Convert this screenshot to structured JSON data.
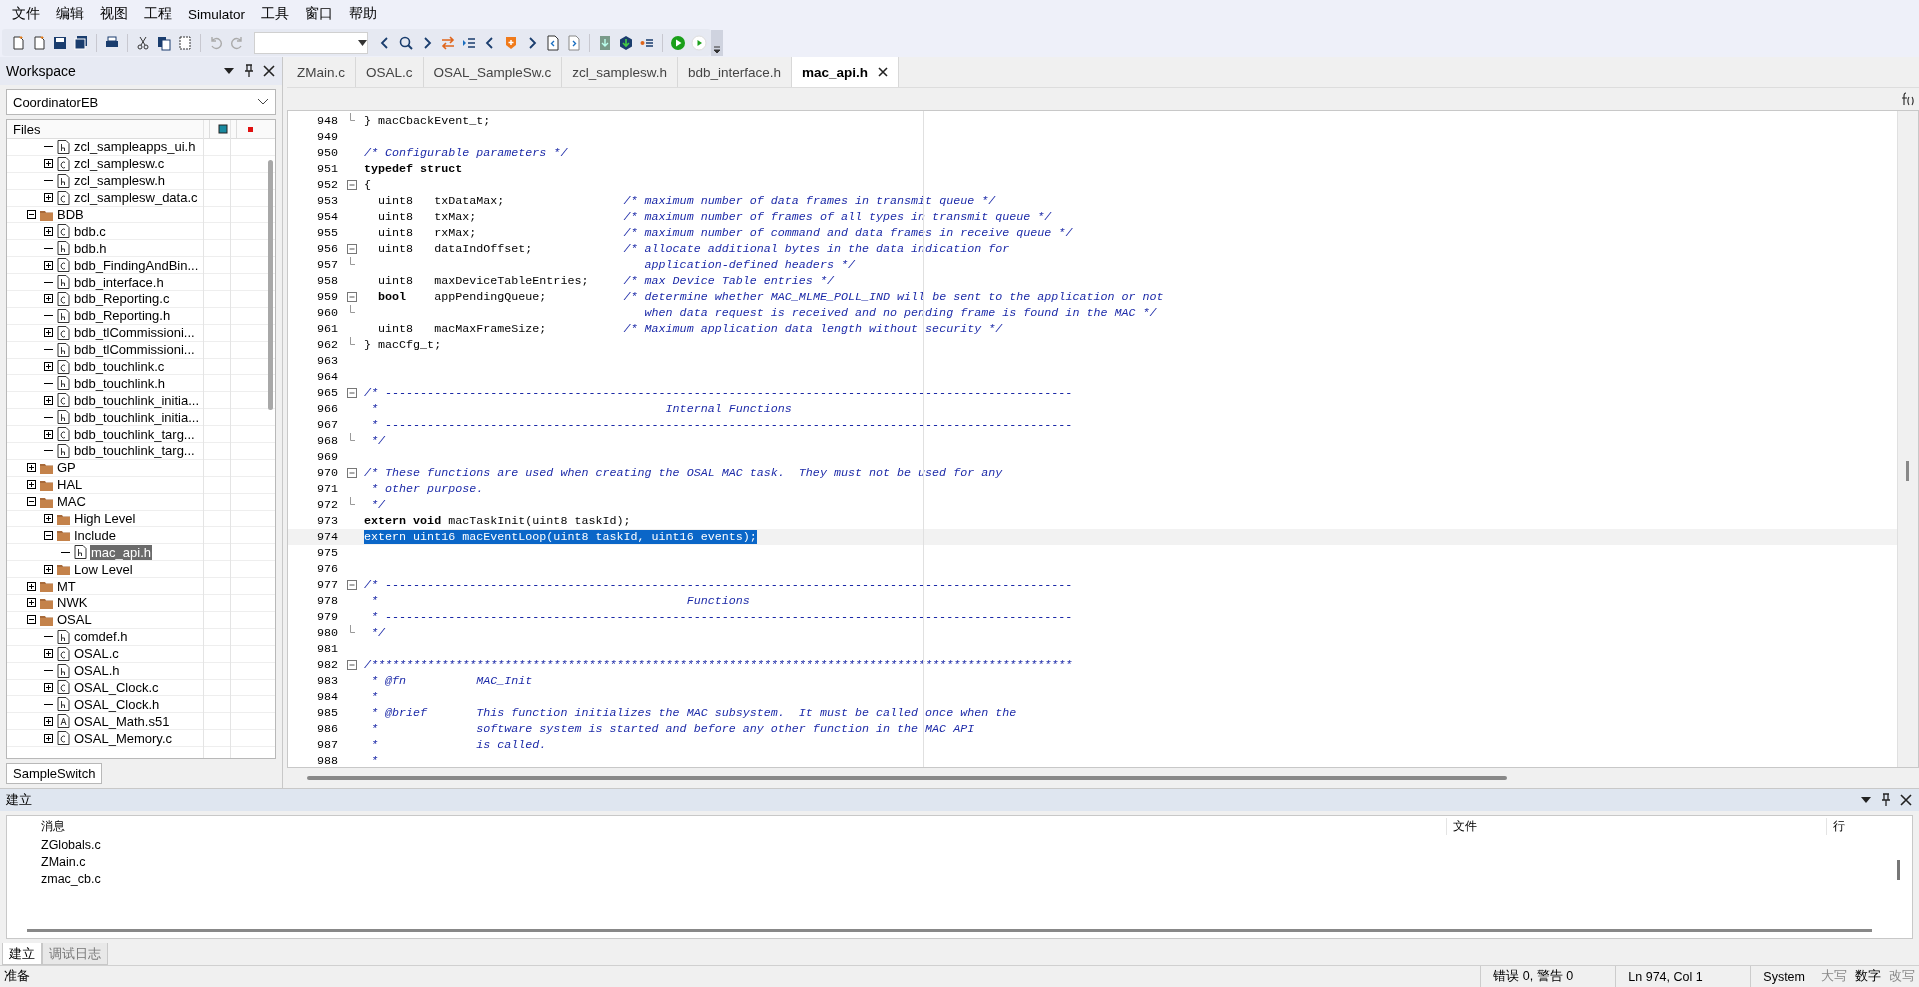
{
  "menu": [
    "文件",
    "编辑",
    "视图",
    "工程",
    "Simulator",
    "工具",
    "窗口",
    "帮助"
  ],
  "workspace": {
    "title": "Workspace",
    "configuration": "CoordinatorEB",
    "files_header": "Files",
    "continued_items": [
      {
        "label": "zcl_sampleapps_ui.h",
        "kind": "h",
        "selected": false
      },
      {
        "label": "zcl_samplesw.c",
        "kind": "c",
        "expanded": false,
        "selected": false
      },
      {
        "label": "zcl_samplesw.h",
        "kind": "h",
        "selected": false
      },
      {
        "label": "zcl_samplesw_data.c",
        "kind": "c",
        "expanded": false,
        "selected": false
      }
    ],
    "items": [
      {
        "label": "BDB",
        "kind": "folder",
        "expanded": true,
        "selected": false,
        "children": [
          {
            "label": "bdb.c",
            "kind": "c",
            "expanded": false,
            "selected": false
          },
          {
            "label": "bdb.h",
            "kind": "h",
            "selected": false
          },
          {
            "label": "bdb_FindingAndBin...",
            "kind": "c",
            "expanded": false,
            "selected": false
          },
          {
            "label": "bdb_interface.h",
            "kind": "h",
            "selected": false
          },
          {
            "label": "bdb_Reporting.c",
            "kind": "c",
            "expanded": false,
            "selected": false
          },
          {
            "label": "bdb_Reporting.h",
            "kind": "h",
            "selected": false
          },
          {
            "label": "bdb_tlCommissioni...",
            "kind": "c",
            "expanded": false,
            "selected": false
          },
          {
            "label": "bdb_tlCommissioni...",
            "kind": "h",
            "selected": false
          },
          {
            "label": "bdb_touchlink.c",
            "kind": "c",
            "expanded": false,
            "selected": false
          },
          {
            "label": "bdb_touchlink.h",
            "kind": "h",
            "selected": false
          },
          {
            "label": "bdb_touchlink_initia...",
            "kind": "c",
            "expanded": false,
            "selected": false
          },
          {
            "label": "bdb_touchlink_initia...",
            "kind": "h",
            "selected": false
          },
          {
            "label": "bdb_touchlink_targ...",
            "kind": "c",
            "expanded": false,
            "selected": false
          },
          {
            "label": "bdb_touchlink_targ...",
            "kind": "h",
            "selected": false
          }
        ]
      },
      {
        "label": "GP",
        "kind": "folder",
        "expanded": false,
        "selected": false
      },
      {
        "label": "HAL",
        "kind": "folder",
        "expanded": false,
        "selected": false
      },
      {
        "label": "MAC",
        "kind": "folder",
        "expanded": true,
        "selected": false,
        "children": [
          {
            "label": "High Level",
            "kind": "folder",
            "expanded": false,
            "selected": false
          },
          {
            "label": "Include",
            "kind": "folder",
            "expanded": true,
            "selected": false,
            "children": [
              {
                "label": "mac_api.h",
                "kind": "h",
                "selected": true
              }
            ]
          },
          {
            "label": "Low Level",
            "kind": "folder",
            "expanded": false,
            "selected": false
          }
        ]
      },
      {
        "label": "MT",
        "kind": "folder",
        "expanded": false,
        "selected": false
      },
      {
        "label": "NWK",
        "kind": "folder",
        "expanded": false,
        "selected": false
      },
      {
        "label": "OSAL",
        "kind": "folder",
        "expanded": true,
        "selected": false,
        "children": [
          {
            "label": "comdef.h",
            "kind": "h",
            "selected": false
          },
          {
            "label": "OSAL.c",
            "kind": "c",
            "expanded": false,
            "selected": false
          },
          {
            "label": "OSAL.h",
            "kind": "h",
            "selected": false
          },
          {
            "label": "OSAL_Clock.c",
            "kind": "c",
            "expanded": false,
            "selected": false
          },
          {
            "label": "OSAL_Clock.h",
            "kind": "h",
            "selected": false
          },
          {
            "label": "OSAL_Math.s51",
            "kind": "asm",
            "expanded": false,
            "selected": false
          },
          {
            "label": "OSAL_Memory.c",
            "kind": "c",
            "expanded": false,
            "selected": false
          }
        ]
      }
    ],
    "bottom_tab": "SampleSwitch"
  },
  "editor": {
    "tabs": [
      {
        "label": "ZMain.c",
        "selected": false
      },
      {
        "label": "OSAL.c",
        "selected": false
      },
      {
        "label": "OSAL_SampleSw.c",
        "selected": false
      },
      {
        "label": "zcl_samplesw.h",
        "selected": false
      },
      {
        "label": "bdb_interface.h",
        "selected": false
      },
      {
        "label": "mac_api.h",
        "selected": true
      }
    ],
    "lines": [
      {
        "number": "948",
        "fold_end": true,
        "selected": false,
        "segments": [
          {
            "kind": "plain",
            "text": "} macCbackEvent_t;"
          }
        ]
      },
      {
        "number": "949",
        "selected": false
      },
      {
        "number": "950",
        "selected": false,
        "segments": [
          {
            "kind": "comment",
            "text": "/* Configurable parameters */"
          }
        ]
      },
      {
        "number": "951",
        "selected": false,
        "segments": [
          {
            "kind": "bold",
            "text": "typedef struct"
          }
        ]
      },
      {
        "number": "952",
        "fold_box": true,
        "selected": false,
        "segments": [
          {
            "kind": "plain",
            "text": "{"
          }
        ]
      },
      {
        "number": "953",
        "selected": false,
        "segments": [
          {
            "kind": "plain",
            "text": "  uint8   txDataMax;                 "
          },
          {
            "kind": "comment",
            "text": "/* maximum number of data frames in transmit queue */"
          }
        ]
      },
      {
        "number": "954",
        "selected": false,
        "segments": [
          {
            "kind": "plain",
            "text": "  uint8   txMax;                     "
          },
          {
            "kind": "comment",
            "text": "/* maximum number of frames of all types in transmit queue */"
          }
        ]
      },
      {
        "number": "955",
        "selected": false,
        "segments": [
          {
            "kind": "plain",
            "text": "  uint8   rxMax;                     "
          },
          {
            "kind": "comment",
            "text": "/* maximum number of command and data frames in receive queue */"
          }
        ]
      },
      {
        "number": "956",
        "fold_box": true,
        "selected": false,
        "segments": [
          {
            "kind": "plain",
            "text": "  uint8   dataIndOffset;             "
          },
          {
            "kind": "comment",
            "text": "/* allocate additional bytes in the data indication for"
          }
        ]
      },
      {
        "number": "957",
        "fold_end": true,
        "selected": false,
        "segments": [
          {
            "kind": "comment",
            "text": "                                        application-defined headers */"
          }
        ]
      },
      {
        "number": "958",
        "selected": false,
        "segments": [
          {
            "kind": "plain",
            "text": "  uint8   maxDeviceTableEntries;     "
          },
          {
            "kind": "comment",
            "text": "/* max Device Table entries */"
          }
        ]
      },
      {
        "number": "959",
        "fold_box": true,
        "selected": false,
        "segments": [
          {
            "kind": "bold",
            "text": "  bool"
          },
          {
            "kind": "plain",
            "text": "    appPendingQueue;           "
          },
          {
            "kind": "comment",
            "text": "/* determine whether MAC_MLME_POLL_IND will be sent to the application or not"
          }
        ]
      },
      {
        "number": "960",
        "fold_end": true,
        "selected": false,
        "segments": [
          {
            "kind": "comment",
            "text": "                                        when data request is received and no pending frame is found in the MAC */"
          }
        ]
      },
      {
        "number": "961",
        "selected": false,
        "segments": [
          {
            "kind": "plain",
            "text": "  uint8   macMaxFrameSize;           "
          },
          {
            "kind": "comment",
            "text": "/* Maximum application data length without security */"
          }
        ]
      },
      {
        "number": "962",
        "fold_end": true,
        "selected": false,
        "segments": [
          {
            "kind": "plain",
            "text": "} macCfg_t;"
          }
        ]
      },
      {
        "number": "963",
        "selected": false
      },
      {
        "number": "964",
        "selected": false
      },
      {
        "number": "965",
        "fold_box": true,
        "selected": false,
        "segments": [
          {
            "kind": "comment",
            "text": "/* --------------------------------------------------------------------------------------------------"
          }
        ]
      },
      {
        "number": "966",
        "selected": false,
        "segments": [
          {
            "kind": "comment",
            "text": " *                                         Internal Functions"
          }
        ]
      },
      {
        "number": "967",
        "selected": false,
        "segments": [
          {
            "kind": "comment",
            "text": " * --------------------------------------------------------------------------------------------------"
          }
        ]
      },
      {
        "number": "968",
        "fold_end": true,
        "selected": false,
        "segments": [
          {
            "kind": "comment",
            "text": " */"
          }
        ]
      },
      {
        "number": "969",
        "selected": false
      },
      {
        "number": "970",
        "fold_box": true,
        "selected": false,
        "segments": [
          {
            "kind": "comment",
            "text": "/* These functions are used when creating the OSAL MAC task.  They must not be used for any"
          }
        ]
      },
      {
        "number": "971",
        "selected": false,
        "segments": [
          {
            "kind": "comment",
            "text": " * other purpose."
          }
        ]
      },
      {
        "number": "972",
        "fold_end": true,
        "selected": false,
        "segments": [
          {
            "kind": "comment",
            "text": " */"
          }
        ]
      },
      {
        "number": "973",
        "selected": false,
        "segments": [
          {
            "kind": "bold",
            "text": "extern void"
          },
          {
            "kind": "plain",
            "text": " macTaskInit(uint8 taskId);"
          }
        ]
      },
      {
        "number": "974",
        "selected": true,
        "segments": [
          {
            "kind": "plain",
            "text": "extern uint16 macEventLoop(uint8 taskId, uint16 events);"
          }
        ]
      },
      {
        "number": "975",
        "selected": false
      },
      {
        "number": "976",
        "selected": false
      },
      {
        "number": "977",
        "fold_box": true,
        "selected": false,
        "segments": [
          {
            "kind": "comment",
            "text": "/* --------------------------------------------------------------------------------------------------"
          }
        ]
      },
      {
        "number": "978",
        "selected": false,
        "segments": [
          {
            "kind": "comment",
            "text": " *                                            Functions"
          }
        ]
      },
      {
        "number": "979",
        "selected": false,
        "segments": [
          {
            "kind": "comment",
            "text": " * --------------------------------------------------------------------------------------------------"
          }
        ]
      },
      {
        "number": "980",
        "fold_end": true,
        "selected": false,
        "segments": [
          {
            "kind": "comment",
            "text": " */"
          }
        ]
      },
      {
        "number": "981",
        "selected": false
      },
      {
        "number": "982",
        "fold_box": true,
        "selected": false,
        "segments": [
          {
            "kind": "comment",
            "text": "/****************************************************************************************************"
          }
        ]
      },
      {
        "number": "983",
        "selected": false,
        "segments": [
          {
            "kind": "comment",
            "text": " * @fn          MAC_Init"
          }
        ]
      },
      {
        "number": "984",
        "selected": false,
        "segments": [
          {
            "kind": "comment",
            "text": " *"
          }
        ]
      },
      {
        "number": "985",
        "selected": false,
        "segments": [
          {
            "kind": "comment",
            "text": " * @brief       This function initializes the MAC subsystem.  It must be called once when the"
          }
        ]
      },
      {
        "number": "986",
        "selected": false,
        "segments": [
          {
            "kind": "comment",
            "text": " *              software system is started and before any other function in the MAC API"
          }
        ]
      },
      {
        "number": "987",
        "selected": false,
        "segments": [
          {
            "kind": "comment",
            "text": " *              is called."
          }
        ]
      },
      {
        "number": "988",
        "selected": false,
        "segments": [
          {
            "kind": "comment",
            "text": " *"
          }
        ]
      }
    ]
  },
  "build": {
    "title": "建立",
    "columns": [
      "消息",
      "文件",
      "行"
    ],
    "rows": [
      {
        "message": "ZGlobals.c"
      },
      {
        "message": "ZMain.c"
      },
      {
        "message": "zmac_cb.c"
      }
    ],
    "tabs": [
      {
        "label": "建立",
        "selected": true
      },
      {
        "label": "调试日志",
        "selected": false
      }
    ]
  },
  "status_bar": {
    "message": "准备",
    "errors": "错误 0, 警告 0",
    "position": "Ln 974, Col 1",
    "mode": "System",
    "indicators": [
      {
        "label": "大写",
        "on": false
      },
      {
        "label": "数字",
        "on": true
      },
      {
        "label": "改写",
        "on": false
      }
    ]
  }
}
